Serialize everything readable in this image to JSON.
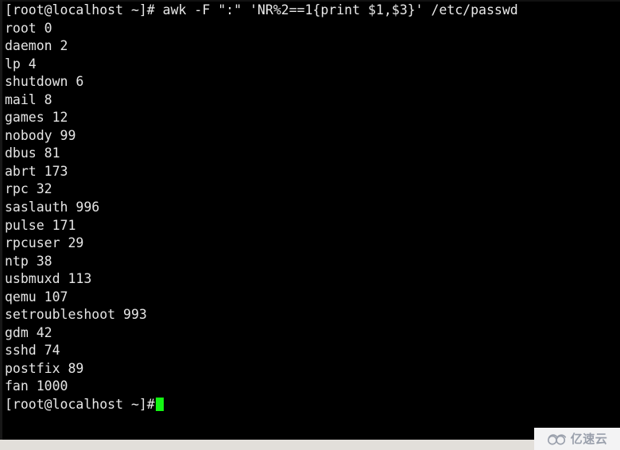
{
  "terminal": {
    "background_color": "#000000",
    "foreground_color": "#e6e6e6",
    "cursor_color": "#13f713",
    "prompt": "[root@localhost ~]#",
    "command": "awk -F \":\" 'NR%2==1{print $1,$3}' /etc/passwd",
    "command_line": "[root@localhost ~]# awk -F \":\" 'NR%2==1{print $1,$3}' /etc/passwd",
    "output_lines": [
      "root 0",
      "daemon 2",
      "lp 4",
      "shutdown 6",
      "mail 8",
      "games 12",
      "nobody 99",
      "dbus 81",
      "abrt 173",
      "rpc 32",
      "saslauth 996",
      "pulse 171",
      "rpcuser 29",
      "ntp 38",
      "usbmuxd 113",
      "qemu 107",
      "setroubleshoot 993",
      "gdm 42",
      "sshd 74",
      "postfix 89",
      "fan 1000"
    ],
    "final_prompt": "[root@localhost ~]#"
  },
  "status_bar": {
    "background_color": "#e2dfda",
    "left_text": "",
    "mid_text": "",
    "mid_text2": "",
    "right_text": "",
    "far_text": ""
  },
  "watermark": {
    "text": "亿速云",
    "logo_icon": "cloud-logo-icon",
    "color": "#9aa0ac",
    "background_color": "#f3f3f4"
  }
}
